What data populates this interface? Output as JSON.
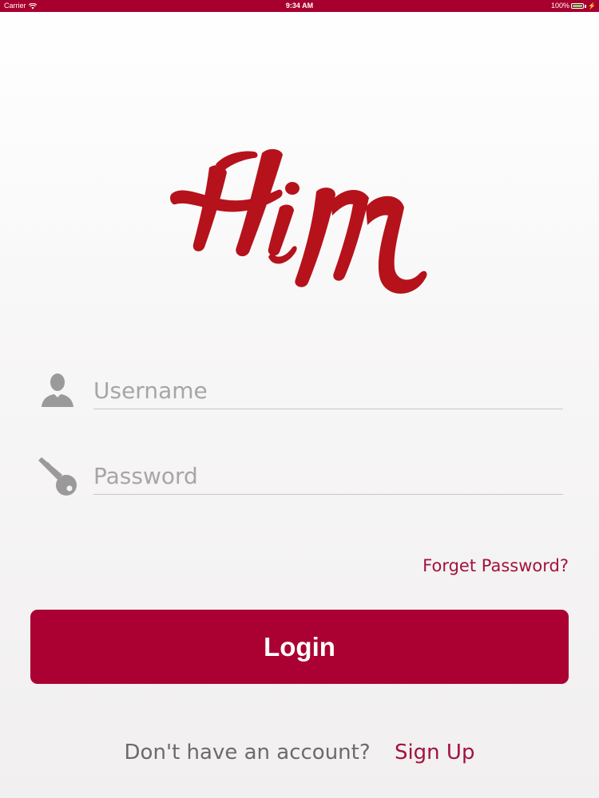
{
  "status_bar": {
    "carrier": "Carrier",
    "time": "9:34 AM",
    "battery": "100%",
    "battery_level": 1.0
  },
  "logo": {
    "text": "HiM",
    "color": "#b5121b"
  },
  "form": {
    "username_placeholder": "Username",
    "username_value": "",
    "password_placeholder": "Password",
    "password_value": ""
  },
  "links": {
    "forgot_password": "Forget Password?",
    "no_account_prompt": "Don't have an account?",
    "sign_up": "Sign Up"
  },
  "buttons": {
    "login": "Login"
  },
  "colors": {
    "brand": "#a8002e",
    "link": "#a3123e",
    "icon_gray": "#9a9a9a"
  }
}
